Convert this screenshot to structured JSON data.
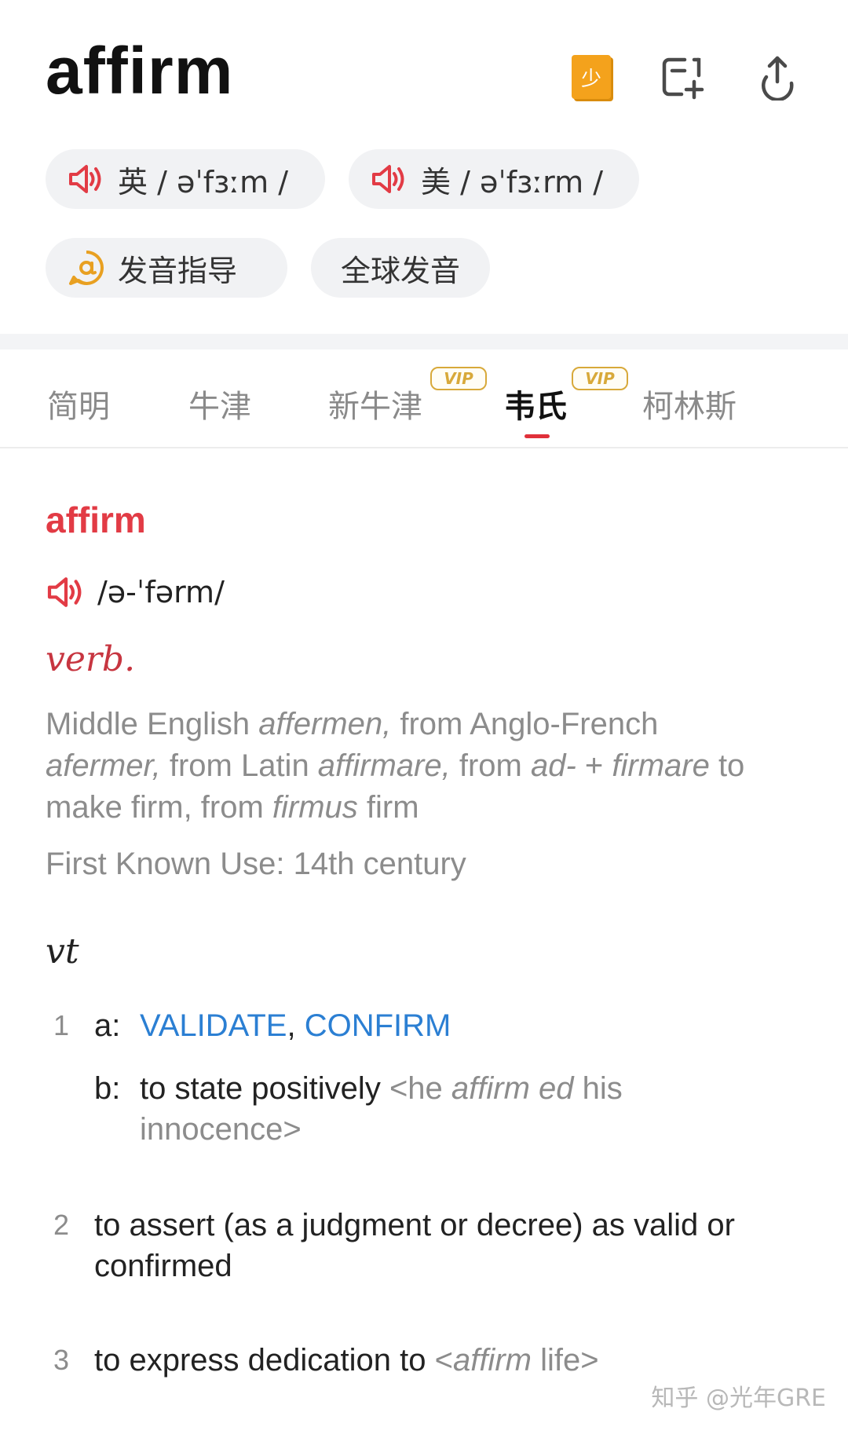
{
  "header": {
    "word": "affirm",
    "badge_label": "少",
    "add_icon": "add-to-wordbook-icon",
    "share_icon": "share-icon"
  },
  "pronunciations": {
    "uk": "英 / əˈfɜːm /",
    "us": "美 / əˈfɜːrm /",
    "guide": "发音指导",
    "global": "全球发音"
  },
  "tabs": [
    {
      "label": "简明",
      "vip": false,
      "active": false
    },
    {
      "label": "牛津",
      "vip": false,
      "active": false
    },
    {
      "label": "新牛津",
      "vip": true,
      "active": false
    },
    {
      "label": "韦氏",
      "vip": true,
      "active": true
    },
    {
      "label": "柯林斯",
      "vip": false,
      "active": false
    }
  ],
  "vip_label": "VIP",
  "entry": {
    "headword": "affirm",
    "pron": "/ə-ˈfərm/",
    "pos": "verb.",
    "etymology": {
      "p1": "Middle English ",
      "i1": "affermen,",
      "p2": " from Anglo-French ",
      "i2": "afermer,",
      "p3": " from Latin ",
      "i3": "affirmare,",
      "p4": " from ",
      "i4": "ad-",
      "p5": " + ",
      "i5": "firmare",
      "p6": " to make firm, from ",
      "i6": "firmus",
      "p7": " firm"
    },
    "first_use": "First Known Use: 14th century",
    "subpos": "vt",
    "senses": [
      {
        "num": "1",
        "a_letter": "a:",
        "a_link1": "VALIDATE",
        "a_sep": ", ",
        "a_link2": "CONFIRM",
        "b_letter": "b:",
        "b_text": "to state positively ",
        "b_ex_open": "<he ",
        "b_ex_italic": "affirm ed",
        "b_ex_close": " his innocence>"
      },
      {
        "num": "2",
        "text": "to assert (as a judgment or decree) as valid or confirmed"
      },
      {
        "num": "3",
        "text": "to express dedication to ",
        "ex_open": "<",
        "ex_italic": "affirm",
        "ex_close": " life>"
      }
    ]
  },
  "watermark": "知乎 @光年GRE",
  "colors": {
    "accent_red": "#e23b45",
    "link_blue": "#2b7fd3",
    "vip_gold": "#d8a93a",
    "badge_orange": "#f4a21c"
  }
}
